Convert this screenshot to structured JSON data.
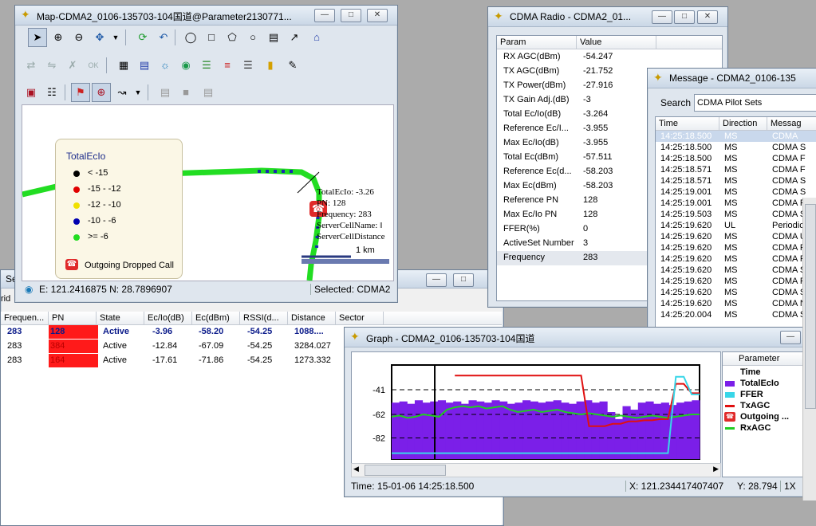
{
  "map": {
    "title": "Map-CDMA2_0106-135703-104国道@Parameter2130771...",
    "legend": {
      "title": "TotalEcIo",
      "items": [
        {
          "label": "< -15",
          "color": "#000000"
        },
        {
          "label": "-15  -  -12",
          "color": "#e00000"
        },
        {
          "label": "-12  -  -10",
          "color": "#f0e000"
        },
        {
          "label": "-10  -  -6",
          "color": "#0000b0"
        },
        {
          "label": ">= -6",
          "color": "#22dd22"
        }
      ],
      "event": "Outgoing Dropped Call"
    },
    "info_lines": [
      "TotalEcIo: -3.26",
      "PN: 128",
      "Frequency: 283",
      "ServerCellName: ‖",
      "ServerCellDistance"
    ],
    "scale": "1 km",
    "status_coords": "E: 121.2416875 N: 28.7896907",
    "status_selected": "Selected: CDMA2"
  },
  "radio": {
    "title": "CDMA Radio - CDMA2_01...",
    "headers": [
      "Param",
      "Value"
    ],
    "rows": [
      [
        "RX AGC(dBm)",
        "-54.247"
      ],
      [
        "TX AGC(dBm)",
        "-21.752"
      ],
      [
        "TX Power(dBm)",
        "-27.916"
      ],
      [
        "TX Gain Adj.(dB)",
        "-3"
      ],
      [
        "Total Ec/Io(dB)",
        "-3.264"
      ],
      [
        "Reference Ec/I...",
        "-3.955"
      ],
      [
        "Max Ec/Io(dB)",
        "-3.955"
      ],
      [
        "Total Ec(dBm)",
        "-57.511"
      ],
      [
        "Reference Ec(d...",
        "-58.203"
      ],
      [
        "Max Ec(dBm)",
        "-58.203"
      ],
      [
        "Reference PN",
        "128"
      ],
      [
        "Max Ec/Io PN",
        "128"
      ],
      [
        "FFER(%)",
        "0"
      ],
      [
        "ActiveSet Number",
        "3"
      ],
      [
        "Frequency",
        "283"
      ]
    ]
  },
  "message": {
    "title": "Message - CDMA2_0106-135",
    "search_label": "Search",
    "search_value": "CDMA Pilot Sets",
    "headers": [
      "Time",
      "Direction",
      "Messag"
    ],
    "rows": [
      [
        "14:25:18.500",
        "MS",
        "CDMA"
      ],
      [
        "14:25:18.500",
        "MS",
        "CDMA S"
      ],
      [
        "14:25:18.500",
        "MS",
        "CDMA F"
      ],
      [
        "14:25:18.571",
        "MS",
        "CDMA F"
      ],
      [
        "14:25:18.571",
        "MS",
        "CDMA S"
      ],
      [
        "14:25:19.001",
        "MS",
        "CDMA S"
      ],
      [
        "14:25:19.001",
        "MS",
        "CDMA F"
      ],
      [
        "14:25:19.503",
        "MS",
        "CDMA S"
      ],
      [
        "14:25:19.620",
        "UL",
        "Periodic"
      ],
      [
        "14:25:19.620",
        "MS",
        "CDMA U"
      ],
      [
        "14:25:19.620",
        "MS",
        "CDMA F"
      ],
      [
        "14:25:19.620",
        "MS",
        "CDMA F"
      ],
      [
        "14:25:19.620",
        "MS",
        "CDMA S"
      ],
      [
        "14:25:19.620",
        "MS",
        "CDMA F"
      ],
      [
        "14:25:19.620",
        "MS",
        "CDMA S"
      ],
      [
        "14:25:19.620",
        "MS",
        "CDMA N"
      ],
      [
        "14:25:20.004",
        "MS",
        "CDMA S"
      ]
    ]
  },
  "sector": {
    "title": "Se",
    "subtitle": "rid",
    "headers": [
      "Frequen...",
      "PN",
      "State",
      "Ec/Io(dB)",
      "Ec(dBm)",
      "RSSI(d...",
      "Distance",
      "Sector"
    ],
    "rows": [
      [
        "283",
        "128",
        "Active",
        "-3.96",
        "-58.20",
        "-54.25",
        "1088....",
        ""
      ],
      [
        "283",
        "384",
        "Active",
        "-12.84",
        "-67.09",
        "-54.25",
        "3284.027",
        ""
      ],
      [
        "283",
        "164",
        "Active",
        "-17.61",
        "-71.86",
        "-54.25",
        "1273.332",
        ""
      ]
    ]
  },
  "graph": {
    "title": "Graph - CDMA2_0106-135703-104国道",
    "param_header": "Parameter",
    "legend": [
      {
        "label": "Time",
        "color": ""
      },
      {
        "label": "TotalEcIo",
        "color": "#7b1fe8"
      },
      {
        "label": "FFER",
        "color": "#38d6e8"
      },
      {
        "label": "TxAGC",
        "color": "#e01010"
      },
      {
        "label": "Outgoing ...",
        "color": ""
      },
      {
        "label": "RxAGC",
        "color": "#22cc22"
      }
    ],
    "status_time": "Time: 15-01-06 14:25:18.500",
    "status_x": "X: 121.234417407407",
    "status_y": "Y: 28.794",
    "status_zoom": "1X"
  },
  "chart_data": {
    "type": "line",
    "yticks": [
      -41,
      -62,
      -82
    ],
    "ylim": [
      -100,
      -20
    ],
    "series": [
      {
        "name": "TotalEcIo",
        "values": [
          -52,
          -51,
          -53,
          -50,
          -52,
          -51,
          -50,
          -52,
          -51,
          -53,
          -50,
          -51,
          -52,
          -50,
          -51,
          -53,
          -52,
          -50,
          -51,
          -52,
          -51,
          -50,
          -52,
          -53,
          -51,
          -50,
          -52,
          -51,
          -60,
          -66,
          -55,
          -58,
          -52,
          -51,
          -53,
          -52,
          -54,
          -52,
          -51,
          -50
        ]
      },
      {
        "name": "RxAGC",
        "values": [
          -64,
          -63,
          -65,
          -64,
          -62,
          -63,
          -64,
          -58,
          -56,
          -55,
          -56,
          -55,
          -57,
          -56,
          -55,
          -58,
          -60,
          -59,
          -58,
          -60,
          -59,
          -58,
          -60,
          -61,
          -62,
          -61,
          -62,
          -63,
          -64,
          -63,
          -64,
          -65,
          -64,
          -63,
          -64,
          -65,
          -64,
          -63,
          -62,
          -62
        ]
      },
      {
        "name": "TxAGC",
        "values": [
          null,
          null,
          null,
          null,
          null,
          null,
          null,
          null,
          -29,
          -29,
          -29,
          -29,
          -29,
          -29,
          -29,
          -29,
          -29,
          -29,
          -29,
          -29,
          -29,
          -29,
          -29,
          -29,
          -29,
          -72,
          -72,
          -72,
          -70,
          -70,
          -68,
          -68,
          -67,
          -67,
          -66,
          -66,
          -36,
          -36,
          -44,
          -44
        ]
      },
      {
        "name": "FFER",
        "values": [
          -95,
          -95,
          -95,
          -95,
          -95,
          -95,
          -95,
          -95,
          -95,
          -95,
          -95,
          -95,
          -95,
          -95,
          -95,
          -95,
          -95,
          -95,
          -95,
          -95,
          -95,
          -95,
          -95,
          -95,
          -95,
          -95,
          -95,
          -95,
          -95,
          -95,
          -95,
          -95,
          -95,
          -95,
          -95,
          -95,
          -30,
          -30,
          -45,
          -45
        ]
      }
    ]
  }
}
